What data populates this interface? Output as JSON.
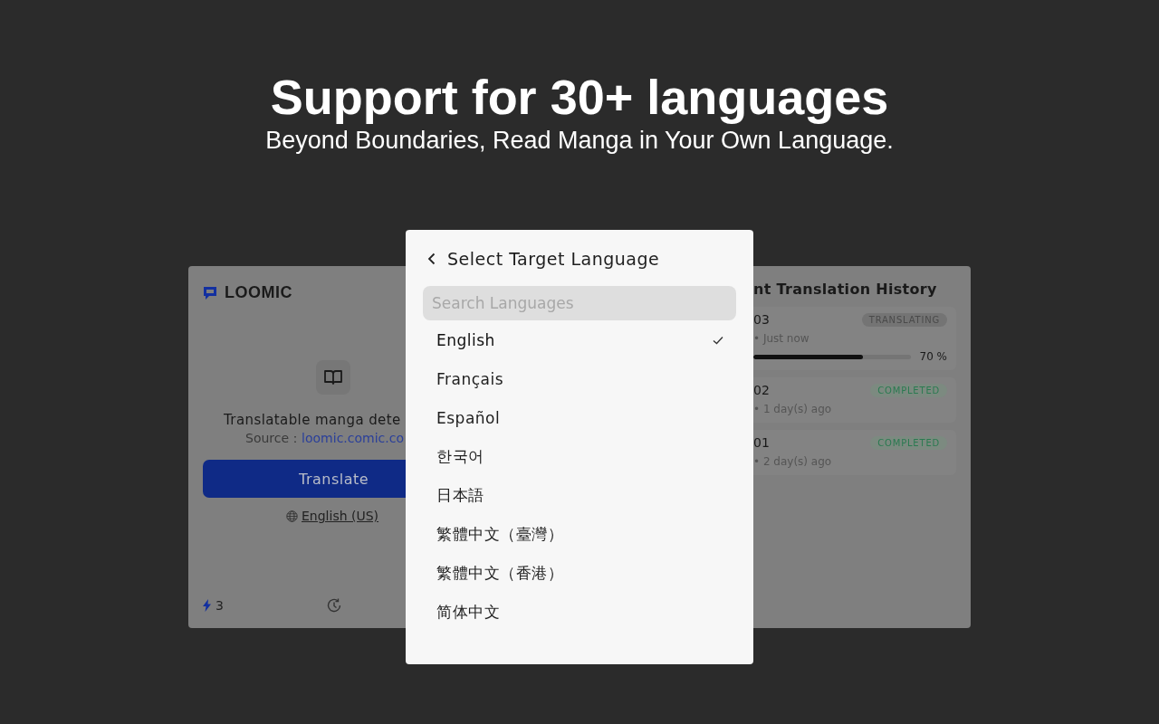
{
  "hero": {
    "title": "Support for 30+ languages",
    "subtitle": "Beyond Boundaries, Read Manga in Your Own Language."
  },
  "popup": {
    "brand": "LOOMIC",
    "detected": "Translatable manga dete",
    "source_label": "Source：",
    "source_link": "loomic.comic.co",
    "translate_button": "Translate",
    "language_link": "English (US)",
    "credits": "3",
    "history_title": "nt Translation History",
    "history": [
      {
        "title": "03",
        "meta": "• Just now",
        "badge": "TRANSLATING",
        "kind": "translating",
        "level": 0.7,
        "percent": "70 %"
      },
      {
        "title": "02",
        "meta": "• 1 day(s) ago",
        "badge": "COMPLETED",
        "kind": "completed"
      },
      {
        "title": "01",
        "meta": "• 2 day(s) ago",
        "badge": "COMPLETED",
        "kind": "completed"
      }
    ]
  },
  "language_dialog": {
    "title": "Select Target Language",
    "search": {
      "placeholder": "Search Languages"
    },
    "languages": [
      {
        "label": "English",
        "selected": true
      },
      {
        "label": "Français",
        "selected": false
      },
      {
        "label": "Español",
        "selected": false
      },
      {
        "label": "한국어",
        "selected": false
      },
      {
        "label": "日本語",
        "selected": false
      },
      {
        "label": "繁體中文（臺灣）",
        "selected": false
      },
      {
        "label": "繁體中文（香港）",
        "selected": false
      },
      {
        "label": "简体中文",
        "selected": false
      }
    ]
  }
}
